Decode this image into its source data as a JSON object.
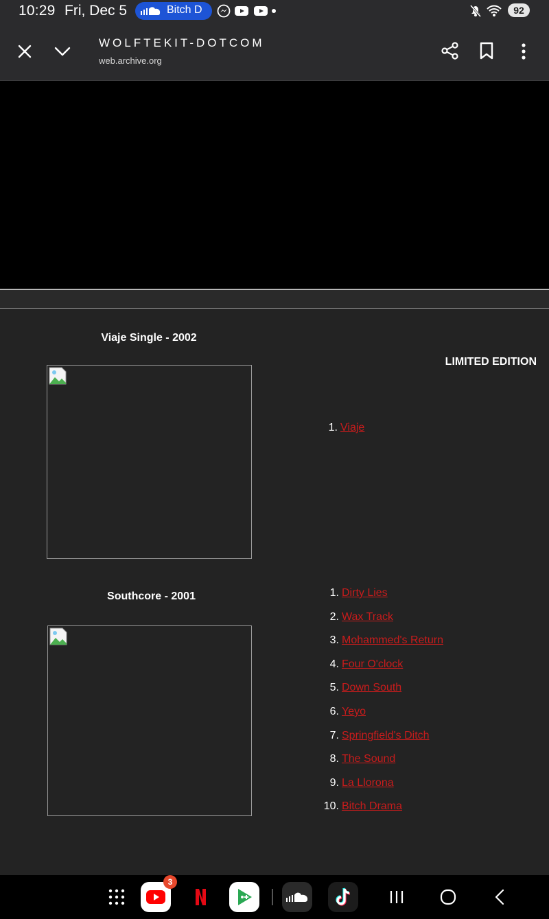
{
  "status_bar": {
    "time": "10:29",
    "date": "Fri, Dec 5",
    "media_pill_text": "Bitch D",
    "battery": "92"
  },
  "toolbar": {
    "site_title": "WOLFTEKIT-DOTCOM",
    "url": "web.archive.org"
  },
  "albums": [
    {
      "title": "Viaje Single - 2002",
      "edition_note": "LIMITED EDITION",
      "tracks": [
        {
          "num": "1.",
          "title": "Viaje"
        }
      ]
    },
    {
      "title": "Southcore - 2001",
      "tracks": [
        {
          "num": "1.",
          "title": "Dirty Lies"
        },
        {
          "num": "2.",
          "title": "Wax Track"
        },
        {
          "num": "3.",
          "title": "Mohammed's Return"
        },
        {
          "num": "4.",
          "title": "Four O'clock"
        },
        {
          "num": "5.",
          "title": "Down South"
        },
        {
          "num": "6.",
          "title": "Yeyo"
        },
        {
          "num": "7.",
          "title": "Springfield's Ditch"
        },
        {
          "num": "8.",
          "title": "The Sound"
        },
        {
          "num": "9.",
          "title": "La Llorona"
        },
        {
          "num": "10.",
          "title": "Bitch Drama"
        }
      ]
    }
  ],
  "nav_bar": {
    "youtube_badge": "3",
    "apps": [
      "app-drawer-icon",
      "youtube-icon",
      "netflix-icon",
      "google-play-games-icon",
      "soundcloud-icon",
      "tiktok-icon"
    ],
    "buttons": [
      "recents-icon",
      "home-icon",
      "back-icon"
    ]
  },
  "colors": {
    "link": "#c81c1c",
    "page_background": "#232323",
    "chrome_background": "#2b2b2d",
    "media_pill": "#1d54d6"
  }
}
